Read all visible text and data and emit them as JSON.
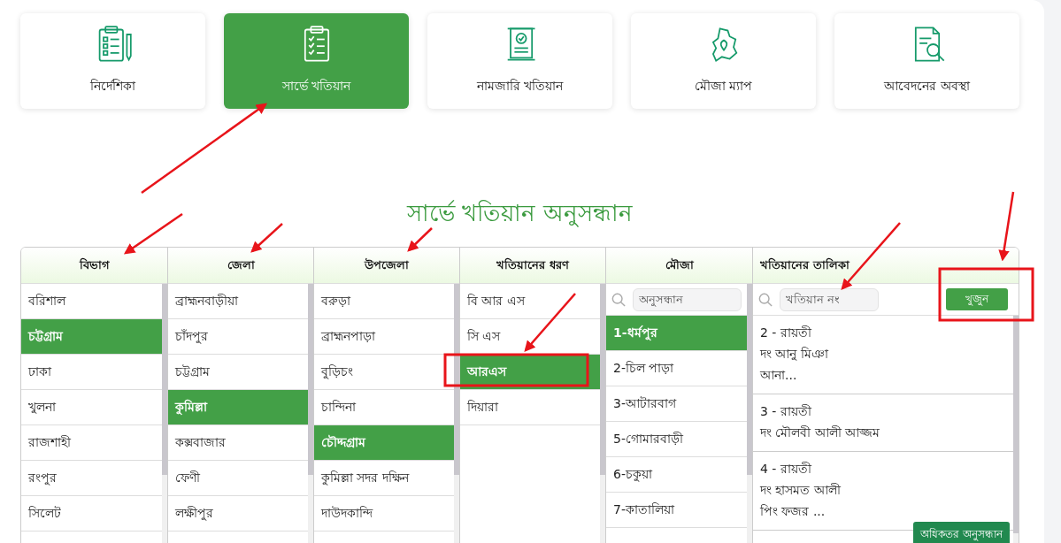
{
  "nav_cards": [
    {
      "label": "নির্দেশিকা",
      "selected": false
    },
    {
      "label": "সার্ভে খতিয়ান",
      "selected": true
    },
    {
      "label": "নামজারি খতিয়ান",
      "selected": false
    },
    {
      "label": "মৌজা ম্যাপ",
      "selected": false
    },
    {
      "label": "আবেদনের অবস্থা",
      "selected": false
    }
  ],
  "title": "সার্ভে খতিয়ান অনুসন্ধান",
  "columns": [
    {
      "heading": "বিভাগ",
      "items": [
        {
          "label": "বরিশাল",
          "selected": false
        },
        {
          "label": "চট্টগ্রাম",
          "selected": true
        },
        {
          "label": "ঢাকা",
          "selected": false
        },
        {
          "label": "খুলনা",
          "selected": false
        },
        {
          "label": "রাজশাহী",
          "selected": false
        },
        {
          "label": "রংপুর",
          "selected": false
        },
        {
          "label": "সিলেট",
          "selected": false
        }
      ]
    },
    {
      "heading": "জেলা",
      "items": [
        {
          "label": "ব্রাহ্মনবাড়ীয়া",
          "selected": false
        },
        {
          "label": "চাঁদপুর",
          "selected": false
        },
        {
          "label": "চট্টগ্রাম",
          "selected": false
        },
        {
          "label": "কুমিল্লা",
          "selected": true
        },
        {
          "label": "কক্সবাজার",
          "selected": false
        },
        {
          "label": "ফেণী",
          "selected": false
        },
        {
          "label": "লক্ষীপুর",
          "selected": false
        }
      ]
    },
    {
      "heading": "উপজেলা",
      "items": [
        {
          "label": "বরুড়া",
          "selected": false
        },
        {
          "label": "ব্রাহ্মনপাড়া",
          "selected": false
        },
        {
          "label": "বুড়িচং",
          "selected": false
        },
        {
          "label": "চান্দিনা",
          "selected": false
        },
        {
          "label": "চৌদ্দগ্রাম",
          "selected": true
        },
        {
          "label": "কুমিল্লা সদর দক্ষিন",
          "selected": false
        },
        {
          "label": "দাউদকান্দি",
          "selected": false
        }
      ]
    },
    {
      "heading": "খতিয়ানের ধরণ",
      "items": [
        {
          "label": "বি আর এস",
          "selected": false
        },
        {
          "label": "সি এস",
          "selected": false
        },
        {
          "label": "আরএস",
          "selected": true
        },
        {
          "label": "দিয়ারা",
          "selected": false
        }
      ]
    },
    {
      "heading": "মৌজা",
      "search": {
        "placeholder": "অনুসন্ধান"
      },
      "items": [
        {
          "label": "1-ধর্মপুর",
          "selected": true
        },
        {
          "label": "2-চিল পাড়া",
          "selected": false
        },
        {
          "label": "3-আটারবাগ",
          "selected": false
        },
        {
          "label": "5-গোমারবাড়ী",
          "selected": false
        },
        {
          "label": "6-চকুয়া",
          "selected": false
        },
        {
          "label": "7-কাতালিয়া",
          "selected": false
        }
      ]
    }
  ],
  "khatian_list": {
    "heading": "খতিয়ানের তালিকা",
    "search": {
      "placeholder": "খতিয়ান নং"
    },
    "search_button": "খুজুন",
    "items": [
      {
        "lines": [
          "2 - রায়তী",
          "দং আনু মিঞা",
          "আনা..."
        ]
      },
      {
        "lines": [
          "3 - রায়তী",
          "দং মৌলবী আলী আজ্জম"
        ]
      },
      {
        "lines": [
          "4 - রায়তী",
          "দং হাসমত আলী",
          "পিং ফজর ..."
        ]
      }
    ],
    "more_button": "অধিকতর অনুসন্ধান"
  }
}
